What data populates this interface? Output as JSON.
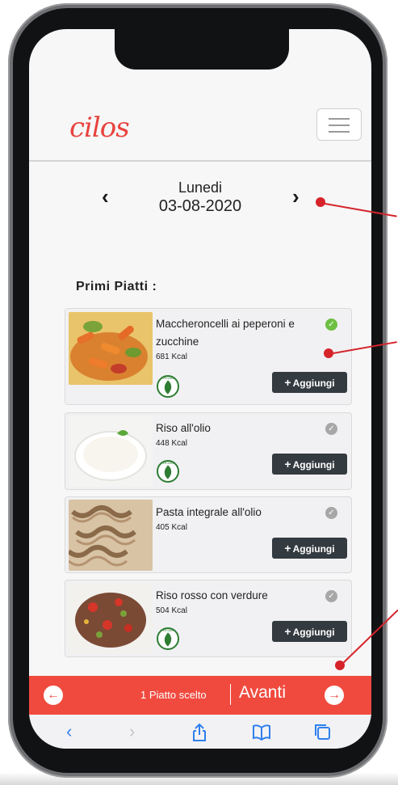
{
  "app": {
    "logo": "cilos"
  },
  "header": {
    "menu_icon": "hamburger-icon"
  },
  "date_nav": {
    "prev": "‹",
    "next": "›",
    "day": "Lunedi",
    "date": "03-08-2020"
  },
  "section": {
    "title": "Primi Piatti :"
  },
  "dishes": [
    {
      "name": "Maccheroncelli ai peperoni e zucchine",
      "kcal": "681 Kcal",
      "selected": true,
      "vegan": "VEGAN",
      "add_label": "Aggiungi"
    },
    {
      "name": "Riso all'olio",
      "kcal": "448 Kcal",
      "selected": false,
      "vegan": "VEGAN",
      "add_label": "Aggiungi"
    },
    {
      "name": "Pasta integrale all'olio",
      "kcal": "405 Kcal",
      "selected": false,
      "vegan": "",
      "add_label": "Aggiungi"
    },
    {
      "name": "Riso rosso con verdure",
      "kcal": "504 Kcal",
      "selected": false,
      "vegan": "VEGAN",
      "add_label": "Aggiungi"
    }
  ],
  "bottom_bar": {
    "chosen": "1 Piatto scelto",
    "next_label": "Avanti"
  },
  "colors": {
    "accent": "#f04a3f",
    "check_on": "#6cbf42",
    "check_off": "#a7a7a7",
    "button": "#333a40"
  }
}
